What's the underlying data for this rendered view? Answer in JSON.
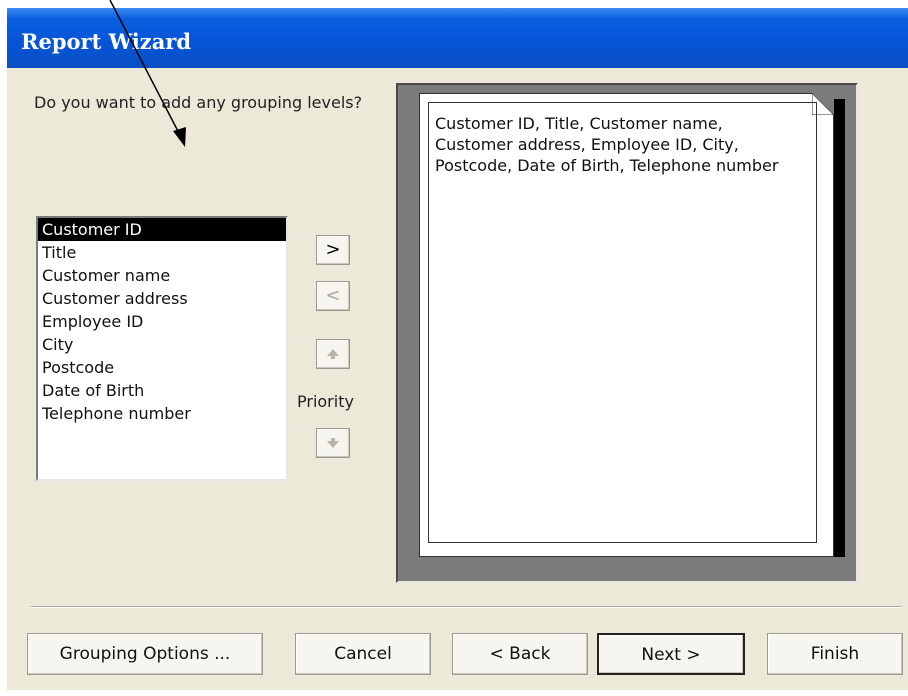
{
  "window": {
    "title": "Report Wizard"
  },
  "prompt": "Do you want to add any grouping levels?",
  "fields": [
    "Customer ID",
    "Title",
    "Customer name",
    "Customer address",
    "Employee ID",
    "City",
    "Postcode",
    "Date of Birth",
    "Telephone number"
  ],
  "selected_field": "Customer ID",
  "move_buttons": {
    "add": ">",
    "remove": "<",
    "priority_up_icon": "up-arrow-icon",
    "priority_down_icon": "down-arrow-icon",
    "priority_label": "Priority"
  },
  "preview": {
    "text": "Customer ID, Title, Customer name, Customer address, Employee ID, City, Postcode, Date of Birth, Telephone number"
  },
  "buttons": {
    "grouping_options": "Grouping Options ...",
    "cancel": "Cancel",
    "back": "< Back",
    "next": "Next >",
    "finish": "Finish"
  },
  "colors": {
    "title_bar": "#0554d6",
    "dialog_bg": "#ece9d8",
    "selection": "#000000"
  }
}
